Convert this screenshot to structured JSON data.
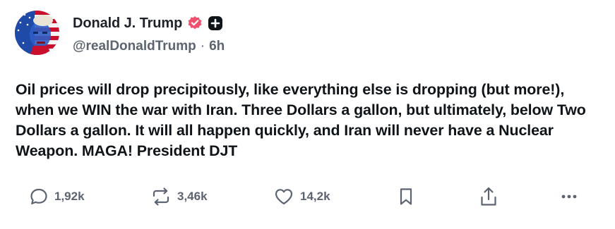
{
  "author": {
    "display_name": "Donald J. Trump",
    "handle": "@realDonaldTrump",
    "separator": "·",
    "time": "6h",
    "verified_icon": "verified-badge-icon",
    "plus_icon": "plus-badge-icon"
  },
  "post": {
    "text": "Oil prices will drop precipitously, like everything else is dropping (but more!), when we WIN the war with Iran. Three Dollars a gallon, but ultimately, below Two Dollars a gallon. It will all happen quickly, and Iran will never have a Nuclear Weapon. MAGA! President DJT"
  },
  "actions": {
    "replies": "1,92k",
    "reposts": "3,46k",
    "likes": "14,2k",
    "icons": [
      "reply-icon",
      "repost-icon",
      "like-icon",
      "bookmark-icon",
      "share-icon",
      "more-icon"
    ]
  },
  "colors": {
    "text": "#0f1419",
    "muted": "#5b6470",
    "verified_badge": "#f0506e",
    "background": "#ffffff"
  }
}
